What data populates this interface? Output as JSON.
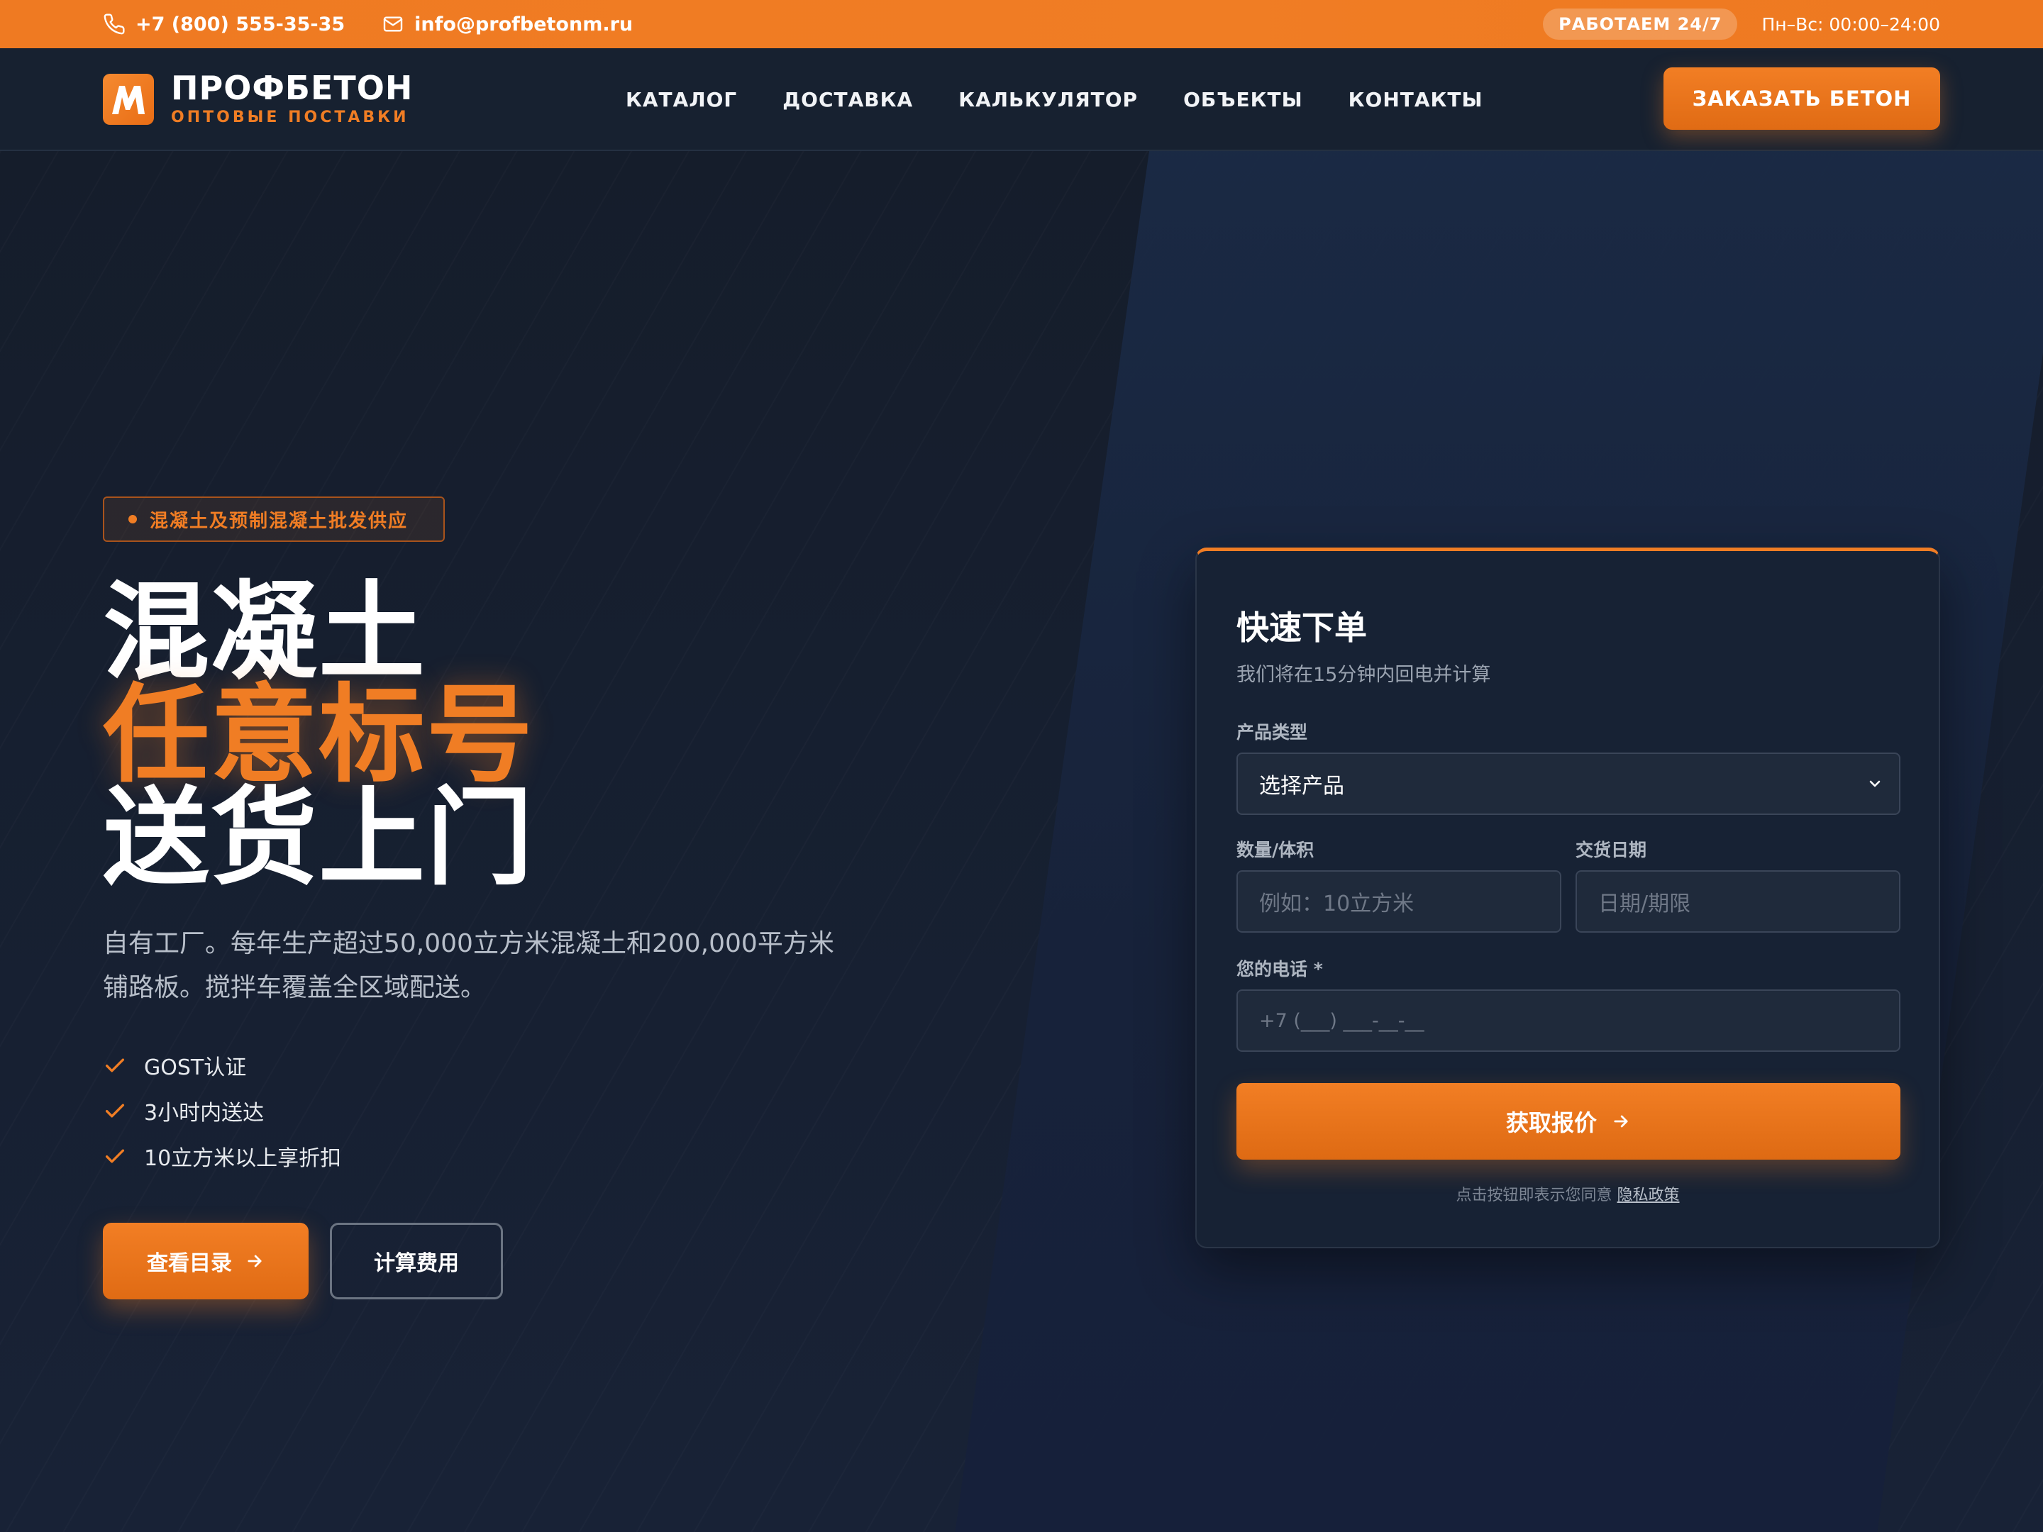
{
  "topbar": {
    "phone": "+7 (800) 555-35-35",
    "email": "info@profbetonm.ru",
    "badge": "РАБОТАЕМ 24/7",
    "hours": "Пн–Вс: 00:00–24:00"
  },
  "header": {
    "logo_name": "ПРОФБЕТОН",
    "logo_sub": "ОПТОВЫЕ ПОСТАВКИ",
    "nav": [
      {
        "label": "КАТАЛОГ"
      },
      {
        "label": "ДОСТАВКА"
      },
      {
        "label": "КАЛЬКУЛЯТОР"
      },
      {
        "label": "ОБЪЕКТЫ"
      },
      {
        "label": "КОНТАКТЫ"
      }
    ],
    "cta": "ЗАКАЗАТЬ БЕТОН"
  },
  "hero": {
    "tagline": "混凝土及预制混凝土批发供应",
    "headline": [
      "混凝土",
      "任意标号",
      "送货上门"
    ],
    "description": "自有工厂。每年生产超过50,000立方米混凝土和200,000平方米铺路板。搅拌车覆盖全区域配送。",
    "features": [
      "GOST认证",
      "3小时内送达",
      "10立方米以上享折扣"
    ],
    "btn_primary": "查看目录",
    "btn_secondary": "计算费用"
  },
  "form": {
    "title": "快速下单",
    "subtitle": "我们将在15分钟内回电并计算",
    "product_label": "产品类型",
    "product_value": "选择产品",
    "quantity_label": "数量/体积",
    "quantity_placeholder": "例如：10立方米",
    "date_label": "交货日期",
    "date_placeholder": "日期/期限",
    "phone_label": "您的电话 *",
    "phone_placeholder": "+7 (___) ___-__-__",
    "submit": "获取报价",
    "privacy_text": "点击按钮即表示您同意",
    "privacy_link": "隐私政策"
  },
  "colors": {
    "accent": "#f07d24",
    "background": "#151d2b",
    "card": "#172234"
  },
  "icons": [
    "phone-icon",
    "mail-icon",
    "logo-m-icon",
    "check-icon",
    "arrow-right-icon",
    "chevron-down-icon"
  ]
}
